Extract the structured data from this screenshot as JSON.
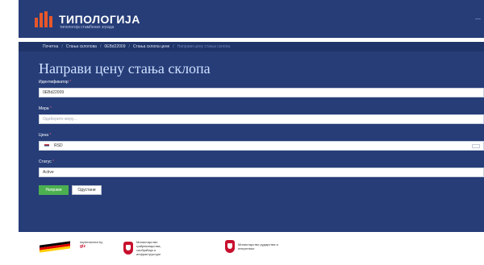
{
  "header": {
    "logo_text": "ТИПОЛОГИЈА",
    "logo_sub": "типологија стамбених зграда",
    "right_text": "—"
  },
  "breadcrumb": {
    "items": [
      "Почетна",
      "Стања склопова",
      "0EBd22009",
      "Стања склопа цене"
    ],
    "current": "Направи цену стања склопа"
  },
  "page": {
    "title": "Направи цену стања склопа"
  },
  "form": {
    "identifier": {
      "label": "Идентификатор",
      "value": "0EBd22009"
    },
    "measure": {
      "label": "Мера",
      "placeholder": "Одаберите меру..."
    },
    "price": {
      "label": "Цена",
      "value": "RSD"
    },
    "status": {
      "label": "Статус",
      "value": "Active"
    },
    "required_mark": "*"
  },
  "buttons": {
    "save": "Направи",
    "cancel": "Одустани"
  },
  "footer": {
    "partner1": "Deutsche Zusammenarbeit",
    "partner2_pre": "implemented by",
    "partner2": "giz",
    "ministry1": "Министарство грађевинарства, саобраћаја и инфраструктуре",
    "ministry2": "Министарство рударства и енергетике"
  },
  "colors": {
    "header_bg": "#263d78",
    "accent": "#e8572b",
    "save_button": "#4caf50",
    "required": "#ff5a5a"
  }
}
